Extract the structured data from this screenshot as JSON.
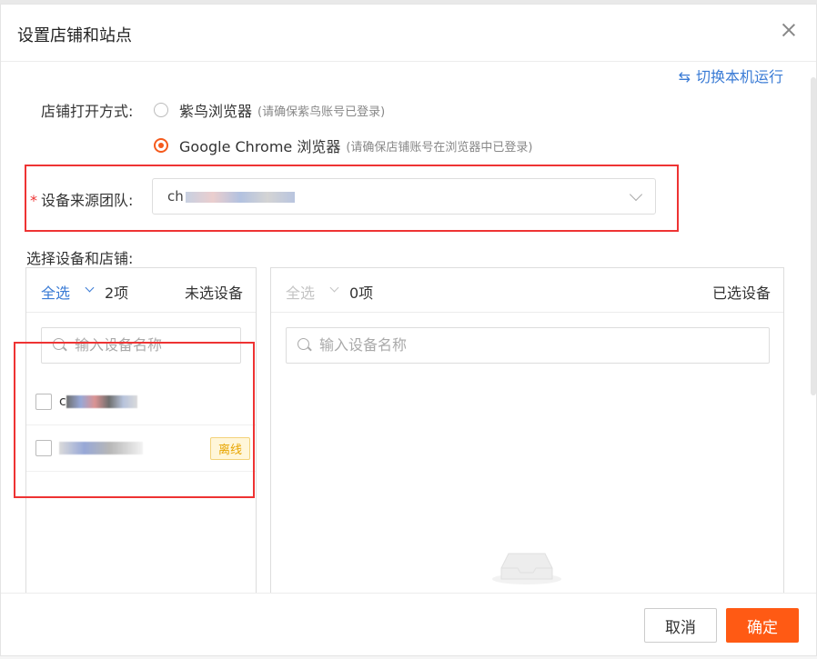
{
  "dialog": {
    "title": "设置店铺和站点"
  },
  "switch_link": {
    "icon": "swap-icon",
    "label": "切换本机运行"
  },
  "open_mode": {
    "label": "店铺打开方式:",
    "options": [
      {
        "label": "紫鸟浏览器",
        "hint": "(请确保紫鸟账号已登录)",
        "checked": false
      },
      {
        "label": "Google Chrome 浏览器",
        "hint": "(请确保店铺账号在浏览器中已登录)",
        "checked": true
      }
    ]
  },
  "team": {
    "required_mark": "*",
    "label": "设备来源团队:",
    "value": "ch"
  },
  "section_label": "选择设备和店铺:",
  "left_panel": {
    "select_all": "全选",
    "count": "2项",
    "title": "未选设备",
    "search_placeholder": "输入设备名称",
    "items": [
      {
        "name": "c",
        "badge": ""
      },
      {
        "name": "",
        "badge": "离线"
      }
    ]
  },
  "right_panel": {
    "select_all": "全选",
    "count": "0项",
    "title": "已选设备",
    "search_placeholder": "输入设备名称"
  },
  "footer": {
    "cancel": "取消",
    "ok": "确定"
  },
  "colors": {
    "accent": "#ff5a14",
    "link": "#3a7bd5",
    "highlight_box": "#ee3333",
    "offline_badge": "#e8a500"
  }
}
